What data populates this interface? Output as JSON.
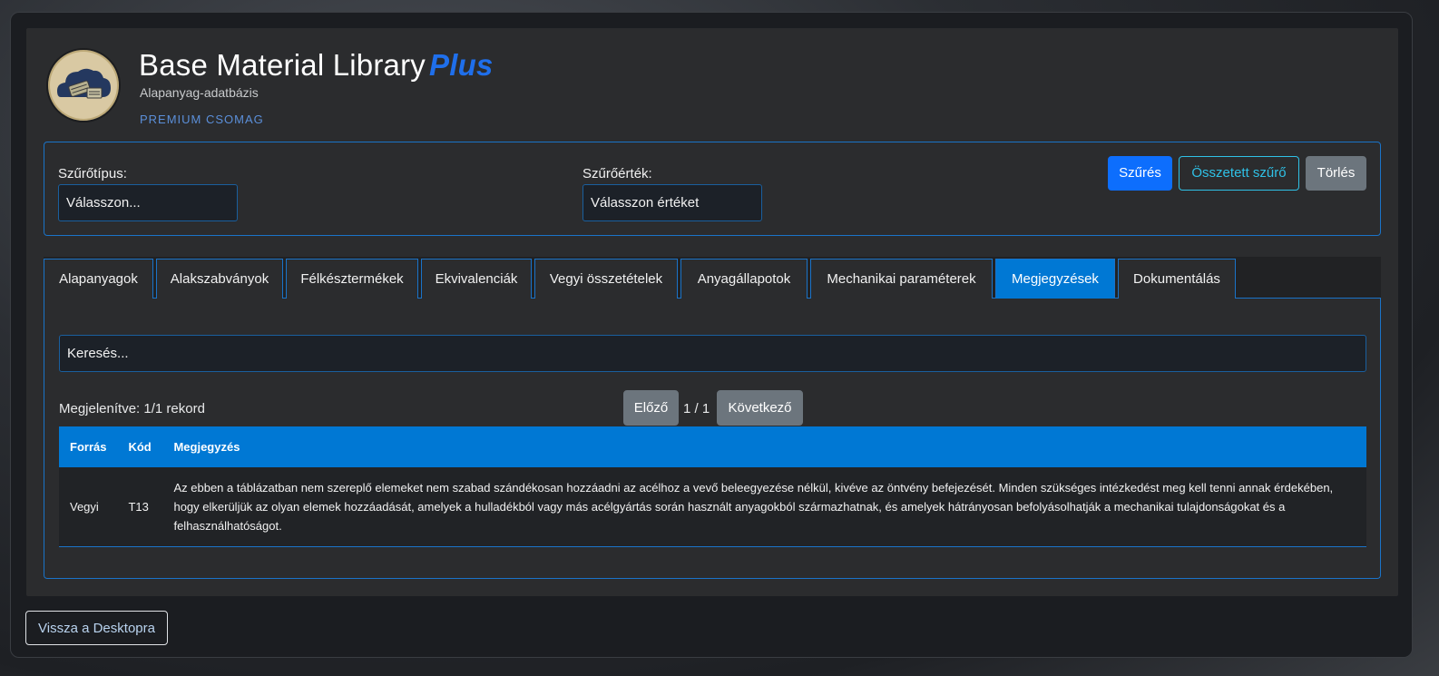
{
  "header": {
    "title": "Base Material Library",
    "title_accent": "Plus",
    "subtitle": "Alapanyag-adatbázis",
    "package": "PREMIUM CSOMAG"
  },
  "filter": {
    "type_label": "Szűrőtípus:",
    "type_value": "Válasszon...",
    "value_label": "Szűrőérték:",
    "value_value": "Válasszon értéket",
    "filter_button": "Szűrés",
    "compound_button": "Összetett szűrő",
    "clear_button": "Törlés"
  },
  "tabs": [
    {
      "label": "Alapanyagok"
    },
    {
      "label": "Alakszabványok"
    },
    {
      "label": "Félkésztermékek"
    },
    {
      "label": "Ekvivalenciák"
    },
    {
      "label": "Vegyi összetételek"
    },
    {
      "label": "Anyagállapotok"
    },
    {
      "label": "Mechanikai paraméterek"
    },
    {
      "label": "Megjegyzések",
      "active": true
    },
    {
      "label": "Dokumentálás"
    }
  ],
  "content": {
    "search_placeholder": "Keresés...",
    "record_count": "Megjelenítve: 1/1 rekord",
    "prev_button": "Előző",
    "page_info": "1 / 1",
    "next_button": "Következő",
    "columns": [
      "Forrás",
      "Kód",
      "Megjegyzés"
    ],
    "rows": [
      {
        "source": "Vegyi",
        "code": "T13",
        "note": "Az ebben a táblázatban nem szereplő elemeket nem szabad szándékosan hozzáadni az acélhoz a vevő beleegyezése nélkül, kivéve az öntvény befejezését. Minden szükséges intézkedést meg kell tenni annak érdekében, hogy elkerüljük az olyan elemek hozzáadását, amelyek a hulladékból vagy más acélgyártás során használt anyagokból származhatnak, és amelyek hátrányosan befolyásolhatják a mechanikai tulajdonságokat és a felhasználhatóságot."
      }
    ]
  },
  "footer": {
    "back_button": "Vissza a Desktopra"
  },
  "colors": {
    "accent": "#0078d4",
    "primary": "#0d6efd",
    "info": "#2fc1e6",
    "secondary": "#6c757d",
    "border": "#1a73c8"
  }
}
